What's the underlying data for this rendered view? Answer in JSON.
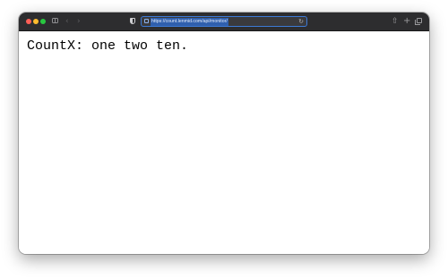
{
  "browser": {
    "url": "https://count.lenmid.com/api/monitor/",
    "icons": {
      "sidebar": "sidebar-icon",
      "back": "chevron-left-icon",
      "forward": "chevron-right-icon",
      "privacy": "shield-icon",
      "site": "page-icon",
      "reload": "reload-icon",
      "share": "share-icon",
      "new_tab": "plus-icon",
      "tabs": "tab-overview-icon"
    },
    "colors": {
      "close": "#fe5f57",
      "minimize": "#febc2e",
      "maximize": "#28c840",
      "titlebar": "#2d2d2f",
      "url_focus": "#3d7ad6"
    }
  },
  "page": {
    "text": "CountX: one two ten."
  }
}
